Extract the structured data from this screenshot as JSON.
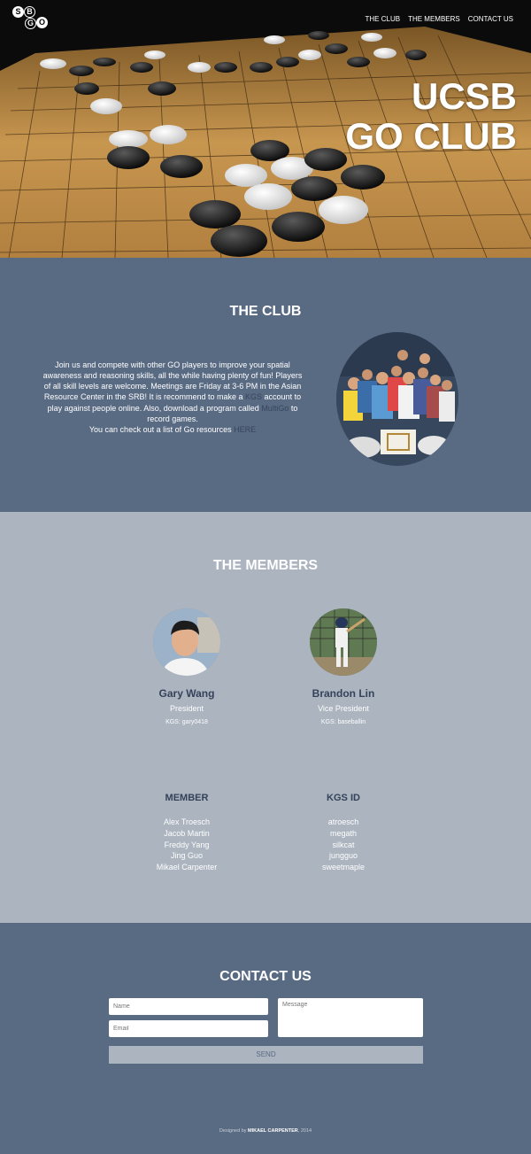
{
  "logo": {
    "letters": [
      "S",
      "B",
      "G",
      "O"
    ]
  },
  "nav": {
    "items": [
      "THE CLUB",
      "THE MEMBERS",
      "CONTACT US"
    ]
  },
  "hero": {
    "title_line1": "UCSB",
    "title_line2": "GO CLUB"
  },
  "club": {
    "title": "THE CLUB",
    "text1": "Join us and compete with other GO players to improve your spatial awareness and reasoning skills, all the while having plenty of fun! Players of all skill levels are welcome. Meetings are Friday at 3-6 PM in the Asian Resource Center in the SRB! It is recommend to make a ",
    "kgs_link": "KGS",
    "text2": " account to play against people online. Also, download a program called ",
    "multigo_link": "MultiGo",
    "text3": " to record games.",
    "resources_text": "You can check out a list of Go resources ",
    "here_link": "HERE"
  },
  "members": {
    "title": "THE MEMBERS",
    "officers": [
      {
        "name": "Gary Wang",
        "role": "President",
        "kgs": "KGS: gary0418"
      },
      {
        "name": "Brandon Lin",
        "role": "Vice President",
        "kgs": "KGS: baseballin"
      }
    ],
    "member_header": "MEMBER",
    "kgs_header": "KGS ID",
    "list": [
      {
        "name": "Alex Troesch",
        "kgs": "atroesch"
      },
      {
        "name": "Jacob Martin",
        "kgs": "megath"
      },
      {
        "name": "Freddy Yang",
        "kgs": "silkcat"
      },
      {
        "name": "Jing Guo",
        "kgs": "jungguo"
      },
      {
        "name": "Mikael Carpenter",
        "kgs": "sweetmaple"
      }
    ]
  },
  "contact": {
    "title": "CONTACT US",
    "name_placeholder": "Name",
    "email_placeholder": "Email",
    "message_placeholder": "Message",
    "send_label": "SEND"
  },
  "footer": {
    "prefix": "Designed by ",
    "author": "MIKAEL CARPENTER",
    "suffix": ", 2014"
  }
}
